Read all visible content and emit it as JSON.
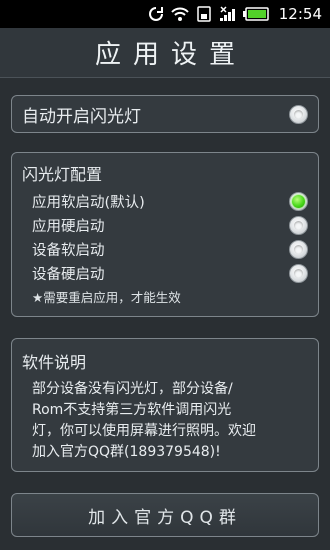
{
  "status_bar": {
    "time": "12:54",
    "icons": [
      "sync-icon",
      "wifi-icon",
      "sim-card-icon",
      "signal-icon",
      "battery-icon"
    ]
  },
  "title": "应用设置",
  "auto_flash": {
    "label": "自动开启闪光灯",
    "checked": false
  },
  "flash_config": {
    "heading": "闪光灯配置",
    "options": [
      {
        "label": "应用软启动(默认)",
        "selected": true
      },
      {
        "label": "应用硬启动",
        "selected": false
      },
      {
        "label": "设备软启动",
        "selected": false
      },
      {
        "label": "设备硬启动",
        "selected": false
      }
    ],
    "note": "★需要重启应用，才能生效"
  },
  "about": {
    "heading": "软件说明",
    "lines": [
      "部分设备没有闪光灯，部分设备/",
      "Rom不支持第三方软件调用闪光",
      "灯，你可以使用屏幕进行照明。欢迎",
      "加入官方QQ群(189379548)!"
    ]
  },
  "join_button": "加入官方QQ群",
  "colors": {
    "background": "#2a2f33",
    "selected_green": "#49d81a"
  }
}
